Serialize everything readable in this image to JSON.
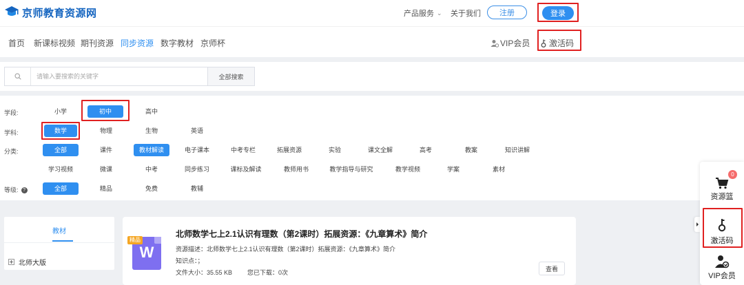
{
  "header": {
    "logo_text": "京师教育资源网",
    "product_services": "产品服务",
    "about_us": "关于我们",
    "register": "注册",
    "login": "登录"
  },
  "nav": {
    "items": [
      "首页",
      "新课标视频",
      "期刊资源",
      "同步资源",
      "数字教材",
      "京师杯"
    ],
    "active": "同步资源",
    "vip": "VIP会员",
    "activation_code": "激活码"
  },
  "search": {
    "placeholder": "请输入要搜索的关键字",
    "button": "全部搜索"
  },
  "filter": {
    "stage": {
      "label": "学段:",
      "options": [
        "小学",
        "初中",
        "高中"
      ],
      "selected": "初中"
    },
    "subject": {
      "label": "学科:",
      "options": [
        "数学",
        "物理",
        "生物",
        "英语"
      ],
      "selected": "数学"
    },
    "category": {
      "label": "分类:",
      "row1": [
        "全部",
        "课件",
        "教材解读",
        "电子课本",
        "中考专栏",
        "拓展资源",
        "实验",
        "课文全解",
        "高考",
        "教案",
        "知识讲解"
      ],
      "row2": [
        "学习视频",
        "微课",
        "中考",
        "同步练习",
        "课标及解读",
        "教师用书",
        "教学指导与研究",
        "教学视频",
        "学案",
        "素材"
      ],
      "selected_all": "全部",
      "selected_active": "教材解读"
    },
    "level": {
      "label": "等级:",
      "help": "?",
      "options": [
        "全部",
        "精品",
        "免费",
        "教辅"
      ],
      "selected": "全部"
    }
  },
  "sidebar": {
    "tab": "教材",
    "tree_item": "北师大版"
  },
  "resource": {
    "badge": "精品",
    "file_letter": "W",
    "title": "北师数学七上2.1认识有理数（第2课时）拓展资源：《九章算术》简介",
    "description": "资源描述：北师数学七上2.1认识有理数（第2课时）拓展资源：《九章算术》简介",
    "knowledge": "知识点：；",
    "file_size": "文件大小：35.55 KB",
    "downloaded": "您已下载：0次",
    "view_button": "查看"
  },
  "float_panel": {
    "cart_count": "0",
    "cart_label": "资源篮",
    "activation_label": "激活码",
    "vip_label": "VIP会员"
  },
  "colors": {
    "accent": "#2f8ff0",
    "highlight_box": "#e02020",
    "badge": "#f5a623",
    "file_icon": "#7e6ff0"
  }
}
